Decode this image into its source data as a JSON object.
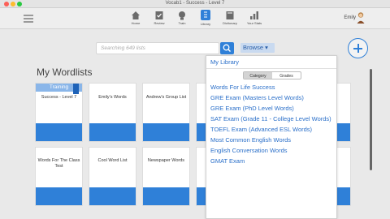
{
  "window": {
    "title": "Vocab1 - Success - Level 7"
  },
  "toolbar": {
    "items": [
      {
        "label": "Home",
        "icon": "home-icon"
      },
      {
        "label": "Review",
        "icon": "review-icon"
      },
      {
        "label": "Train",
        "icon": "train-icon"
      },
      {
        "label": "Library",
        "icon": "library-icon"
      },
      {
        "label": "Dictionary",
        "icon": "dictionary-icon"
      },
      {
        "label": "Your Stats",
        "icon": "stats-icon"
      }
    ],
    "active_index": 3,
    "user_name": "Emily"
  },
  "search": {
    "placeholder": "Searching 649 lists",
    "browse_label": "Browse ▾"
  },
  "main": {
    "heading": "My Wordlists",
    "cards": [
      {
        "name": "Success - Level 7",
        "badge": "Training"
      },
      {
        "name": "Emily's Words"
      },
      {
        "name": "Andrew's Group List"
      },
      {
        "name": "Words For The Class Test"
      },
      {
        "name": "Cool Word List"
      },
      {
        "name": "Newspaper Words"
      }
    ]
  },
  "browse_menu": {
    "title": "My Library",
    "segments": [
      "Category",
      "Grades"
    ],
    "selected_segment": "Category",
    "items": [
      "Words For Life Success",
      "GRE Exam (Masters Level Words)",
      "GRE Exam (PhD Level Words)",
      "SAT Exam (Grade 11 - College Level Words)",
      "TOEFL Exam (Advanced ESL Words)",
      "Most Common English Words",
      "English Conversation Words",
      "GMAT Exam"
    ]
  },
  "colors": {
    "accent": "#2f80d8",
    "link": "#2a6fc9",
    "training_badge": "#8ab6e9"
  }
}
